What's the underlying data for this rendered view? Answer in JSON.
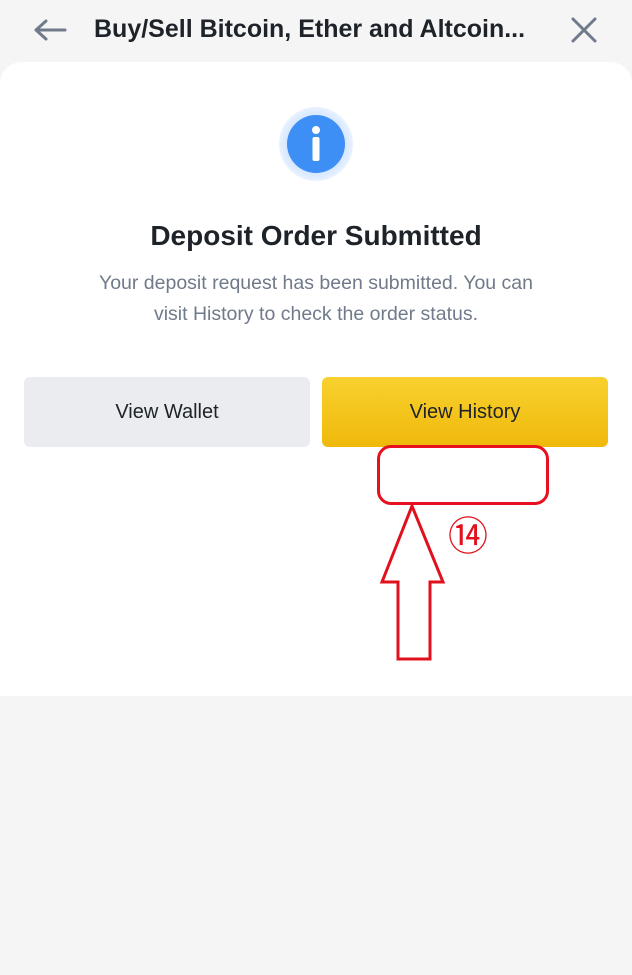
{
  "header": {
    "title": "Buy/Sell Bitcoin, Ether and Altcoin...",
    "back_icon": "arrow-left-icon",
    "close_icon": "close-icon"
  },
  "dialog": {
    "icon": "info-icon",
    "heading": "Deposit Order Submitted",
    "description": "Your deposit request has been submitted. You can visit History to check the order status."
  },
  "actions": {
    "view_wallet_label": "View Wallet",
    "view_history_label": "View History"
  },
  "annotation": {
    "step_label": "⑭",
    "color": "#e8101e"
  },
  "colors": {
    "primary_button": "#f0b90b",
    "secondary_button": "#eaecef",
    "info_blue": "#3d8ff5",
    "text_dark": "#1e2329",
    "text_muted": "#707a8a"
  }
}
